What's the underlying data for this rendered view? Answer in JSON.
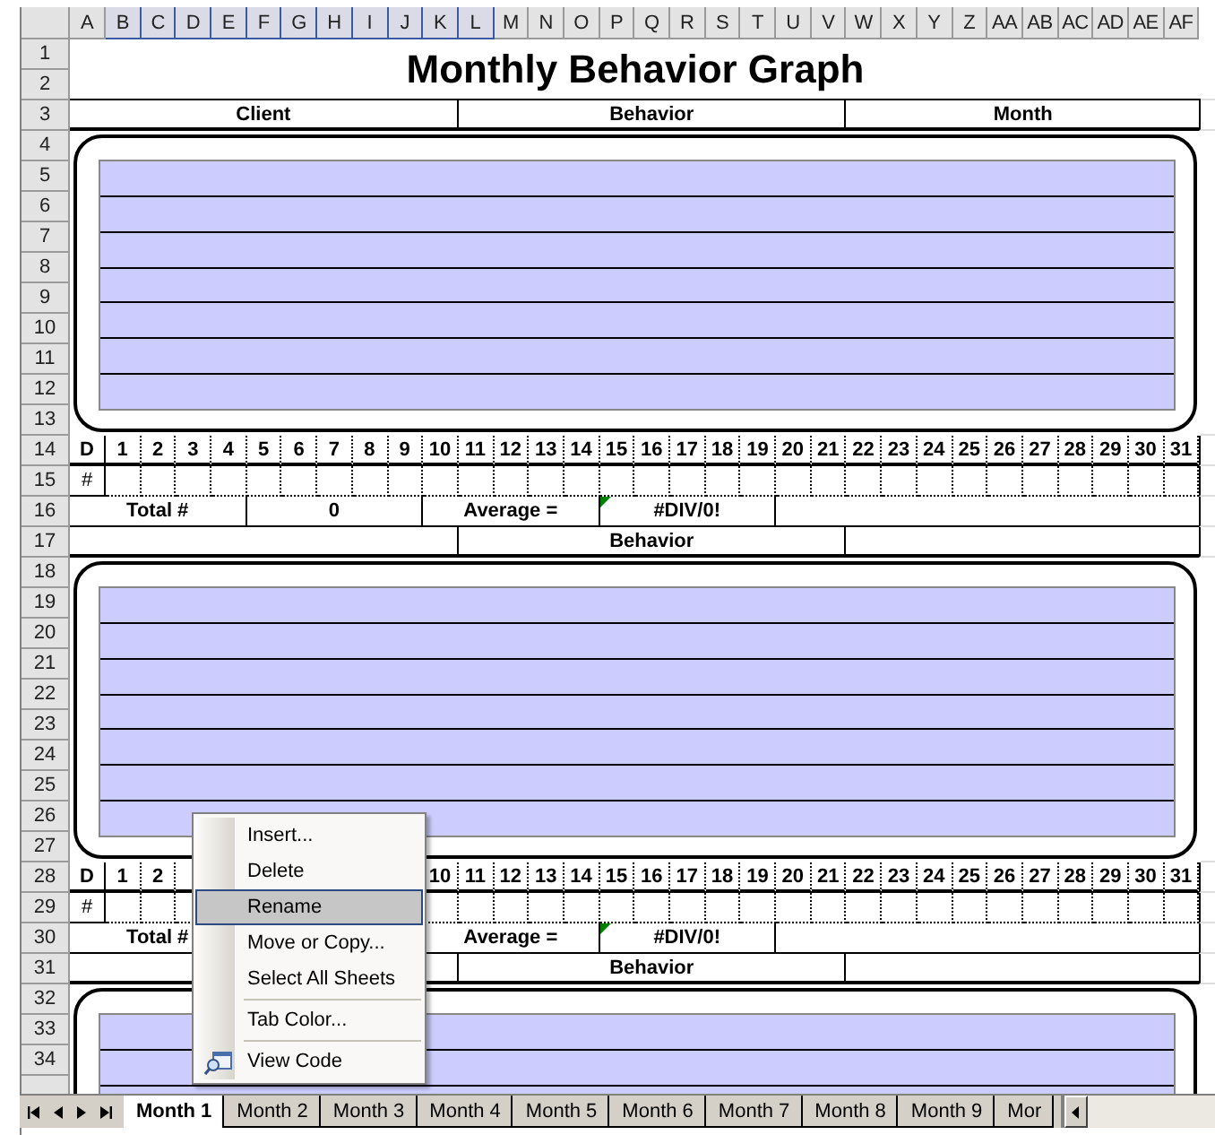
{
  "column_headers": [
    {
      "label": "A",
      "selected": false
    },
    {
      "label": "B",
      "selected": true
    },
    {
      "label": "C",
      "selected": true
    },
    {
      "label": "D",
      "selected": true
    },
    {
      "label": "E",
      "selected": true
    },
    {
      "label": "F",
      "selected": true
    },
    {
      "label": "G",
      "selected": true
    },
    {
      "label": "H",
      "selected": true
    },
    {
      "label": "I",
      "selected": true
    },
    {
      "label": "J",
      "selected": true
    },
    {
      "label": "K",
      "selected": true
    },
    {
      "label": "L",
      "selected": true
    },
    {
      "label": "M",
      "selected": false
    },
    {
      "label": "N",
      "selected": false
    },
    {
      "label": "O",
      "selected": false
    },
    {
      "label": "P",
      "selected": false
    },
    {
      "label": "Q",
      "selected": false
    },
    {
      "label": "R",
      "selected": false
    },
    {
      "label": "S",
      "selected": false
    },
    {
      "label": "T",
      "selected": false
    },
    {
      "label": "U",
      "selected": false
    },
    {
      "label": "V",
      "selected": false
    },
    {
      "label": "W",
      "selected": false
    },
    {
      "label": "X",
      "selected": false
    },
    {
      "label": "Y",
      "selected": false
    },
    {
      "label": "Z",
      "selected": false
    },
    {
      "label": "AA",
      "selected": false
    },
    {
      "label": "AB",
      "selected": false
    },
    {
      "label": "AC",
      "selected": false
    },
    {
      "label": "AD",
      "selected": false
    },
    {
      "label": "AE",
      "selected": false
    },
    {
      "label": "AF",
      "selected": false
    }
  ],
  "title": {
    "rows": [
      "1",
      "2"
    ],
    "text": "Monthly Behavior Graph"
  },
  "header": {
    "row": "3",
    "client": "Client",
    "behavior": "Behavior",
    "month": "Month"
  },
  "blocks": [
    {
      "kind": "graph",
      "rows": [
        "4",
        "5",
        "6",
        "7",
        "8",
        "9",
        "10",
        "11",
        "12",
        "13"
      ]
    },
    {
      "kind": "days",
      "row": "14",
      "label": "D",
      "days": [
        "1",
        "2",
        "3",
        "4",
        "5",
        "6",
        "7",
        "8",
        "9",
        "10",
        "11",
        "12",
        "13",
        "14",
        "15",
        "16",
        "17",
        "18",
        "19",
        "20",
        "21",
        "22",
        "23",
        "24",
        "25",
        "26",
        "27",
        "28",
        "29",
        "30",
        "31"
      ]
    },
    {
      "kind": "counts",
      "row": "15",
      "label": "#"
    },
    {
      "kind": "totals",
      "row": "16",
      "total_label": "Total #",
      "total": "0",
      "average_label": "Average =",
      "average": "#DIV/0!"
    },
    {
      "kind": "behavior",
      "row": "17",
      "label": "Behavior"
    },
    {
      "kind": "graph",
      "rows": [
        "18",
        "19",
        "20",
        "21",
        "22",
        "23",
        "24",
        "25",
        "26",
        "27"
      ]
    },
    {
      "kind": "days",
      "row": "28",
      "label": "D",
      "days": [
        "1",
        "2"
      ],
      "days_after_menu": [
        "10",
        "11",
        "12",
        "13",
        "14",
        "15",
        "16",
        "17",
        "18",
        "19",
        "20",
        "21",
        "22",
        "23",
        "24",
        "25",
        "26",
        "27",
        "28",
        "29",
        "30",
        "31"
      ]
    },
    {
      "kind": "counts",
      "row": "29",
      "label": "#"
    },
    {
      "kind": "totals",
      "row": "30",
      "total_label": "Total #",
      "average_label": "Average =",
      "average": "#DIV/0!"
    },
    {
      "kind": "behavior",
      "row": "31",
      "label": "Behavior"
    },
    {
      "kind": "graph",
      "rows": [
        "32",
        "33",
        "34"
      ]
    }
  ],
  "sheet_tabs": [
    {
      "label": "Month 1",
      "selected": true
    },
    {
      "label": "Month 2",
      "selected": false
    },
    {
      "label": "Month 3",
      "selected": false
    },
    {
      "label": "Month 4",
      "selected": false
    },
    {
      "label": "Month 5",
      "selected": false
    },
    {
      "label": "Month 6",
      "selected": false
    },
    {
      "label": "Month 7",
      "selected": false
    },
    {
      "label": "Month 8",
      "selected": false
    },
    {
      "label": "Month 9",
      "selected": false
    },
    {
      "label": "Mor",
      "selected": false
    }
  ],
  "context_menu": [
    {
      "kind": "item",
      "label": "Insert...",
      "selected": false
    },
    {
      "kind": "item",
      "label": "Delete",
      "selected": false
    },
    {
      "kind": "item",
      "label": "Rename",
      "selected": true
    },
    {
      "kind": "item",
      "label": "Move or Copy...",
      "selected": false
    },
    {
      "kind": "item",
      "label": "Select All Sheets",
      "selected": false
    },
    {
      "kind": "separator"
    },
    {
      "kind": "item",
      "label": "Tab Color...",
      "selected": false
    },
    {
      "kind": "separator"
    },
    {
      "kind": "icon_item",
      "label": "View Code",
      "selected": false
    }
  ]
}
